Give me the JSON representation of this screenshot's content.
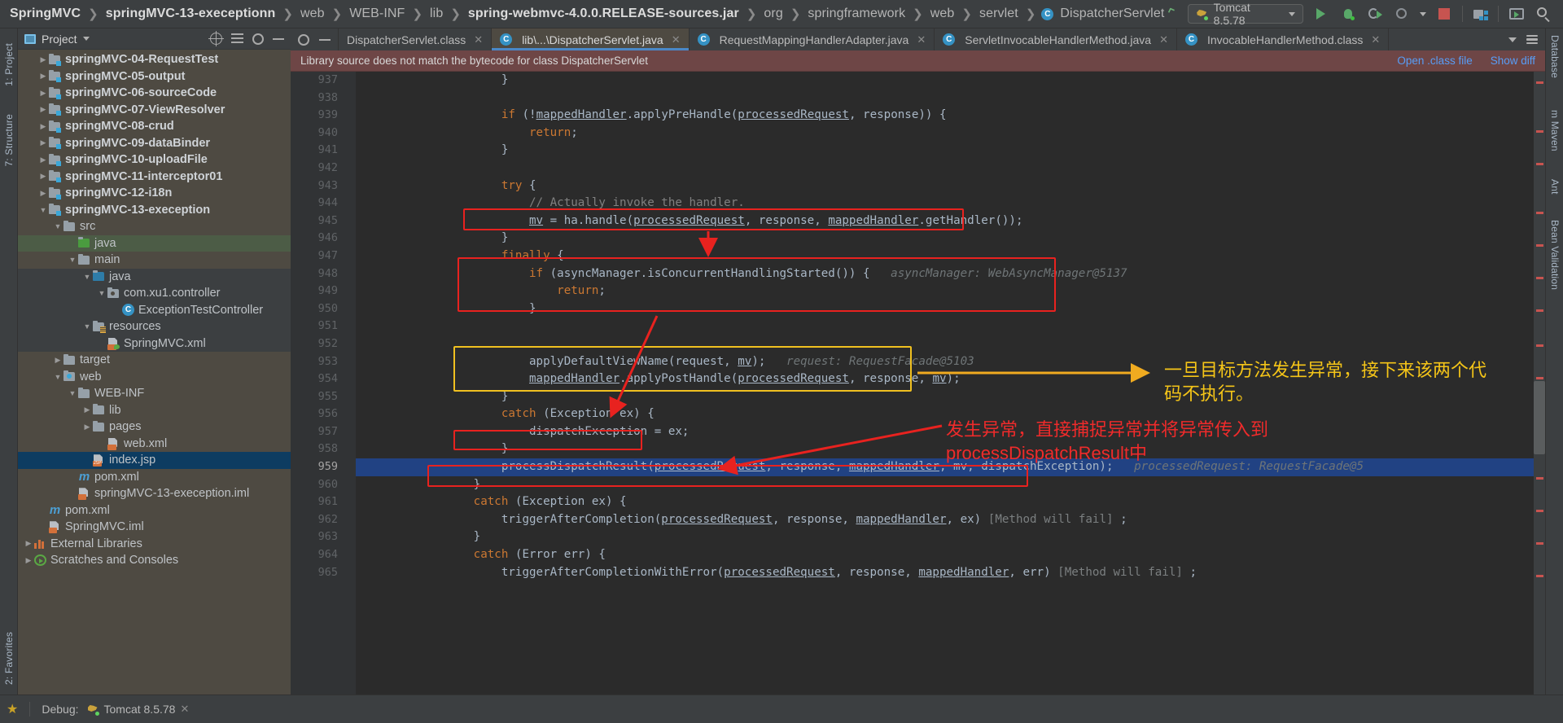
{
  "breadcrumb": [
    {
      "label": "SpringMVC",
      "strong": true
    },
    {
      "label": "springMVC-13-execeptionn",
      "strong": true
    },
    {
      "label": "web",
      "strong": false
    },
    {
      "label": "WEB-INF",
      "strong": false
    },
    {
      "label": "lib",
      "strong": false
    },
    {
      "label": "spring-webmvc-4.0.0.RELEASE-sources.jar",
      "strong": true
    },
    {
      "label": "org",
      "strong": false
    },
    {
      "label": "springframework",
      "strong": false
    },
    {
      "label": "web",
      "strong": false
    },
    {
      "label": "servlet",
      "strong": false
    },
    {
      "label": "DispatcherServlet",
      "strong": false,
      "icon": "class-badge-icon"
    }
  ],
  "toolbar": {
    "build_icon": "hammer-icon",
    "run_config": "Tomcat 8.5.78",
    "run_config_icon": "tomcat-icon",
    "dropdown_icon": "chevron-down-icon",
    "buttons": [
      {
        "name": "run-button",
        "icon": "play-icon"
      },
      {
        "name": "debug-button",
        "icon": "bug-icon"
      },
      {
        "name": "rerun-button",
        "icon": "rerun-icon"
      },
      {
        "name": "profile-button",
        "icon": "profiler-icon"
      },
      {
        "name": "stop-button",
        "icon": "stop-icon"
      },
      {
        "name": "project-structure-button",
        "icon": "project-structure-icon"
      },
      {
        "name": "update-app-button",
        "icon": "window-icon"
      },
      {
        "name": "search-everywhere-button",
        "icon": "search-icon"
      }
    ]
  },
  "left_rail": [
    "1: Project",
    "7: Structure",
    "2: Favorites"
  ],
  "right_rail": [
    "Database",
    "m Maven",
    "Ant",
    "Bean Validation"
  ],
  "project_panel": {
    "title": "Project",
    "title_icon": "project-icon",
    "header_icons": [
      "locate-icon",
      "collapse-all-icon",
      "settings-gear-icon",
      "hide-icon"
    ],
    "tree": [
      {
        "label": "springMVC-04-RequestTest",
        "indent": 1,
        "arrow": "collapsed",
        "icon": "module-folder",
        "bold": true
      },
      {
        "label": "springMVC-05-output",
        "indent": 1,
        "arrow": "collapsed",
        "icon": "module-folder",
        "bold": true
      },
      {
        "label": "springMVC-06-sourceCode",
        "indent": 1,
        "arrow": "collapsed",
        "icon": "module-folder",
        "bold": true
      },
      {
        "label": "springMVC-07-ViewResolver",
        "indent": 1,
        "arrow": "collapsed",
        "icon": "module-folder",
        "bold": true
      },
      {
        "label": "springMVC-08-crud",
        "indent": 1,
        "arrow": "collapsed",
        "icon": "module-folder",
        "bold": true
      },
      {
        "label": "springMVC-09-dataBinder",
        "indent": 1,
        "arrow": "collapsed",
        "icon": "module-folder",
        "bold": true
      },
      {
        "label": "springMVC-10-uploadFile",
        "indent": 1,
        "arrow": "collapsed",
        "icon": "module-folder",
        "bold": true
      },
      {
        "label": "springMVC-11-interceptor01",
        "indent": 1,
        "arrow": "collapsed",
        "icon": "module-folder",
        "bold": true
      },
      {
        "label": "springMVC-12-i18n",
        "indent": 1,
        "arrow": "collapsed",
        "icon": "module-folder",
        "bold": true
      },
      {
        "label": "springMVC-13-exeception",
        "indent": 1,
        "arrow": "expanded",
        "icon": "module-folder",
        "bold": true
      },
      {
        "label": "src",
        "indent": 2,
        "arrow": "expanded",
        "icon": "folder"
      },
      {
        "label": "java",
        "indent": 3,
        "arrow": "none",
        "icon": "folder-green",
        "row_style": "green"
      },
      {
        "label": "main",
        "indent": 3,
        "arrow": "expanded",
        "icon": "folder"
      },
      {
        "label": "java",
        "indent": 4,
        "arrow": "expanded",
        "icon": "folder-blue",
        "row_style": "dark"
      },
      {
        "label": "com.xu1.controller",
        "indent": 5,
        "arrow": "expanded",
        "icon": "package",
        "row_style": "dark"
      },
      {
        "label": "ExceptionTestController",
        "indent": 6,
        "arrow": "none",
        "icon": "class",
        "row_style": "dark"
      },
      {
        "label": "resources",
        "indent": 4,
        "arrow": "expanded",
        "icon": "resources-folder",
        "row_style": "dark"
      },
      {
        "label": "SpringMVC.xml",
        "indent": 5,
        "arrow": "none",
        "icon": "spring-xml",
        "row_style": "dark"
      },
      {
        "label": "target",
        "indent": 2,
        "arrow": "collapsed",
        "icon": "folder"
      },
      {
        "label": "web",
        "indent": 2,
        "arrow": "expanded",
        "icon": "web-folder"
      },
      {
        "label": "WEB-INF",
        "indent": 3,
        "arrow": "expanded",
        "icon": "folder"
      },
      {
        "label": "lib",
        "indent": 4,
        "arrow": "collapsed",
        "icon": "folder"
      },
      {
        "label": "pages",
        "indent": 4,
        "arrow": "collapsed",
        "icon": "folder"
      },
      {
        "label": "web.xml",
        "indent": 5,
        "arrow": "none",
        "icon": "web-xml"
      },
      {
        "label": "index.jsp",
        "indent": 4,
        "arrow": "none",
        "icon": "jsp",
        "row_style": "selected"
      },
      {
        "label": "pom.xml",
        "indent": 3,
        "arrow": "none",
        "icon": "maven"
      },
      {
        "label": "springMVC-13-exeception.iml",
        "indent": 3,
        "arrow": "none",
        "icon": "iml"
      },
      {
        "label": "pom.xml",
        "indent": 1,
        "arrow": "none",
        "icon": "maven"
      },
      {
        "label": "SpringMVC.iml",
        "indent": 1,
        "arrow": "none",
        "icon": "iml"
      },
      {
        "label": "External Libraries",
        "indent": 0,
        "arrow": "collapsed",
        "icon": "libraries"
      },
      {
        "label": "Scratches and Consoles",
        "indent": 0,
        "arrow": "collapsed",
        "icon": "scratches"
      }
    ]
  },
  "editor": {
    "tabs": [
      {
        "label": "DispatcherServlet.class",
        "icon": "none",
        "active": false,
        "closable": true
      },
      {
        "label": "lib\\...\\DispatcherServlet.java",
        "icon": "class-badge-icon",
        "active": true,
        "closable": true
      },
      {
        "label": "RequestMappingHandlerAdapter.java",
        "icon": "class-badge-icon",
        "active": false,
        "closable": true
      },
      {
        "label": "ServletInvocableHandlerMethod.java",
        "icon": "class-badge-icon",
        "active": false,
        "closable": true
      },
      {
        "label": "InvocableHandlerMethod.class",
        "icon": "class-badge-icon",
        "active": false,
        "closable": true
      }
    ],
    "tab_tools": [
      "chevron-down-icon",
      "stack-icon"
    ],
    "notification": {
      "message": "Library source does not match the bytecode for class DispatcherServlet",
      "action_open": "Open .class file",
      "action_diff": "Show diff"
    },
    "line_numbers": [
      "937",
      "938",
      "939",
      "940",
      "941",
      "942",
      "943",
      "944",
      "945",
      "946",
      "947",
      "948",
      "949",
      "950",
      "951",
      "952",
      "953",
      "954",
      "955",
      "956",
      "957",
      "958",
      "959",
      "960",
      "961",
      "962",
      "963",
      "964",
      "965"
    ],
    "code_lines": [
      {
        "n": "937",
        "segments": [
          {
            "t": "                    }",
            "c": "plain"
          }
        ]
      },
      {
        "n": "938",
        "segments": [
          {
            "t": "",
            "c": "plain"
          }
        ]
      },
      {
        "n": "939",
        "segments": [
          {
            "t": "                    ",
            "c": "plain"
          },
          {
            "t": "if",
            "c": "kw"
          },
          {
            "t": " (!",
            "c": "plain"
          },
          {
            "t": "mappedHandler",
            "c": "ul"
          },
          {
            "t": ".applyPreHandle(",
            "c": "plain"
          },
          {
            "t": "processedRequest",
            "c": "ul"
          },
          {
            "t": ", response)) {",
            "c": "plain"
          }
        ]
      },
      {
        "n": "940",
        "segments": [
          {
            "t": "                        ",
            "c": "plain"
          },
          {
            "t": "return",
            "c": "kw"
          },
          {
            "t": ";",
            "c": "plain"
          }
        ]
      },
      {
        "n": "941",
        "segments": [
          {
            "t": "                    }",
            "c": "plain"
          }
        ]
      },
      {
        "n": "942",
        "segments": [
          {
            "t": "",
            "c": "plain"
          }
        ]
      },
      {
        "n": "943",
        "segments": [
          {
            "t": "                    ",
            "c": "plain"
          },
          {
            "t": "try",
            "c": "kw"
          },
          {
            "t": " {",
            "c": "plain"
          }
        ]
      },
      {
        "n": "944",
        "segments": [
          {
            "t": "                        ",
            "c": "plain"
          },
          {
            "t": "// Actually invoke the handler.",
            "c": "cm"
          }
        ]
      },
      {
        "n": "945",
        "segments": [
          {
            "t": "                        ",
            "c": "plain"
          },
          {
            "t": "mv",
            "c": "ul"
          },
          {
            "t": " = ha.handle(",
            "c": "plain"
          },
          {
            "t": "processedRequest",
            "c": "ul"
          },
          {
            "t": ", response, ",
            "c": "plain"
          },
          {
            "t": "mappedHandler",
            "c": "ul"
          },
          {
            "t": ".getHandler());",
            "c": "plain"
          }
        ]
      },
      {
        "n": "946",
        "segments": [
          {
            "t": "                    }",
            "c": "plain"
          }
        ]
      },
      {
        "n": "947",
        "segments": [
          {
            "t": "                    ",
            "c": "plain"
          },
          {
            "t": "finally",
            "c": "kw"
          },
          {
            "t": " {",
            "c": "plain"
          }
        ]
      },
      {
        "n": "948",
        "segments": [
          {
            "t": "                        ",
            "c": "plain"
          },
          {
            "t": "if",
            "c": "kw"
          },
          {
            "t": " (asyncManager.isConcurrentHandlingStarted()) {",
            "c": "plain"
          },
          {
            "t": "   asyncManager: WebAsyncManager@5137",
            "c": "hint"
          }
        ]
      },
      {
        "n": "949",
        "segments": [
          {
            "t": "                            ",
            "c": "plain"
          },
          {
            "t": "return",
            "c": "kw"
          },
          {
            "t": ";",
            "c": "plain"
          }
        ]
      },
      {
        "n": "950",
        "segments": [
          {
            "t": "                        }",
            "c": "plain"
          }
        ]
      },
      {
        "n": "951",
        "segments": [
          {
            "t": "",
            "c": "plain"
          }
        ]
      },
      {
        "n": "952",
        "segments": [
          {
            "t": "",
            "c": "plain"
          }
        ]
      },
      {
        "n": "953",
        "segments": [
          {
            "t": "                        applyDefaultViewName(request, ",
            "c": "plain"
          },
          {
            "t": "mv",
            "c": "ul"
          },
          {
            "t": ");",
            "c": "plain"
          },
          {
            "t": "   request: RequestFacade@5103",
            "c": "hint"
          }
        ]
      },
      {
        "n": "954",
        "segments": [
          {
            "t": "                        ",
            "c": "plain"
          },
          {
            "t": "mappedHandler",
            "c": "ul"
          },
          {
            "t": ".applyPostHandle(",
            "c": "plain"
          },
          {
            "t": "processedRequest",
            "c": "ul"
          },
          {
            "t": ", response, ",
            "c": "plain"
          },
          {
            "t": "mv",
            "c": "ul"
          },
          {
            "t": ");",
            "c": "plain"
          }
        ]
      },
      {
        "n": "955",
        "segments": [
          {
            "t": "                    }",
            "c": "plain"
          }
        ]
      },
      {
        "n": "956",
        "segments": [
          {
            "t": "                    ",
            "c": "plain"
          },
          {
            "t": "catch",
            "c": "kw"
          },
          {
            "t": " (Exception ex) {",
            "c": "plain"
          }
        ]
      },
      {
        "n": "957",
        "segments": [
          {
            "t": "                        dispatchException = ex;",
            "c": "plain"
          }
        ]
      },
      {
        "n": "958",
        "segments": [
          {
            "t": "                    }",
            "c": "plain"
          }
        ]
      },
      {
        "n": "959",
        "segments": [
          {
            "t": "                    processDispatchResult(",
            "c": "plain"
          },
          {
            "t": "processedRequest",
            "c": "ul"
          },
          {
            "t": ", response, ",
            "c": "plain"
          },
          {
            "t": "mappedHandler",
            "c": "ul"
          },
          {
            "t": ", mv, dispatchException);",
            "c": "plain"
          },
          {
            "t": "   processedRequest: RequestFacade@5",
            "c": "hint"
          }
        ],
        "highlight": true
      },
      {
        "n": "960",
        "segments": [
          {
            "t": "                }",
            "c": "plain"
          }
        ]
      },
      {
        "n": "961",
        "segments": [
          {
            "t": "                ",
            "c": "plain"
          },
          {
            "t": "catch",
            "c": "kw"
          },
          {
            "t": " (Exception ex) {",
            "c": "plain"
          }
        ]
      },
      {
        "n": "962",
        "segments": [
          {
            "t": "                    triggerAfterCompletion(",
            "c": "plain"
          },
          {
            "t": "processedRequest",
            "c": "ul"
          },
          {
            "t": ", response, ",
            "c": "plain"
          },
          {
            "t": "mappedHandler",
            "c": "ul"
          },
          {
            "t": ", ex)",
            "c": "plain"
          },
          {
            "t": " [Method will fail]",
            "c": "hint2"
          },
          {
            "t": " ;",
            "c": "plain"
          }
        ]
      },
      {
        "n": "963",
        "segments": [
          {
            "t": "                }",
            "c": "plain"
          }
        ]
      },
      {
        "n": "964",
        "segments": [
          {
            "t": "                ",
            "c": "plain"
          },
          {
            "t": "catch",
            "c": "kw"
          },
          {
            "t": " (Error err) {",
            "c": "plain"
          }
        ]
      },
      {
        "n": "965",
        "segments": [
          {
            "t": "                    triggerAfterCompletionWithError(",
            "c": "plain"
          },
          {
            "t": "processedRequest",
            "c": "ul"
          },
          {
            "t": ", response, ",
            "c": "plain"
          },
          {
            "t": "mappedHandler",
            "c": "ul"
          },
          {
            "t": ", err)",
            "c": "plain"
          },
          {
            "t": " [Method will fail]",
            "c": "hint2"
          },
          {
            "t": " ;",
            "c": "plain"
          }
        ]
      }
    ]
  },
  "annotations": {
    "yellow_note": "一旦目标方法发生异常，接下来该两个代\n码不执行。",
    "red_note": "发生异常，直接捕捉异常并将异常传入到\nprocessDispatchResult中",
    "colors": {
      "red": "#e8221f",
      "yellow": "#f0c020",
      "yellow_text": "#f5c518",
      "red_text": "#ef2b2b"
    }
  },
  "bottom_bar": {
    "debug_label": "Debug:",
    "session_label": "Tomcat 8.5.78",
    "session_icon": "tomcat-icon",
    "close_icon": "close-icon",
    "favorites_star": "star-icon"
  }
}
